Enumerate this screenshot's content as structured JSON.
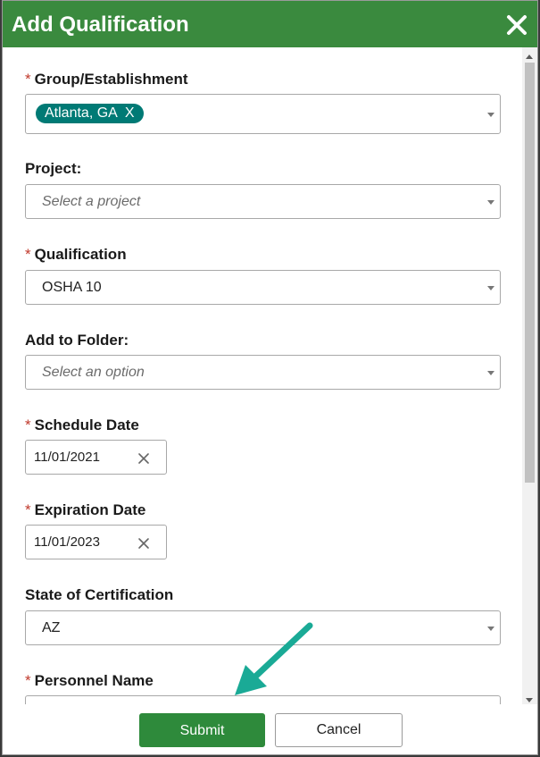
{
  "dialog": {
    "title": "Add Qualification",
    "close_icon": "close-icon"
  },
  "fields": {
    "group": {
      "label": "Group/Establishment",
      "required_mark": "*",
      "tag_text": "Atlanta, GA",
      "tag_remove": "X"
    },
    "project": {
      "label": "Project:",
      "placeholder": "Select a project"
    },
    "qualification": {
      "label": "Qualification",
      "required_mark": "*",
      "value": "OSHA 10"
    },
    "folder": {
      "label": "Add to Folder:",
      "placeholder": "Select an option"
    },
    "schedule_date": {
      "label": "Schedule Date",
      "required_mark": "*",
      "value": "11/01/2021"
    },
    "expiration_date": {
      "label": "Expiration Date",
      "required_mark": "*",
      "value": "11/01/2023"
    },
    "state": {
      "label": "State of Certification",
      "value": "AZ"
    },
    "personnel": {
      "label": "Personnel Name",
      "required_mark": "*"
    }
  },
  "footer": {
    "submit_label": "Submit",
    "cancel_label": "Cancel"
  },
  "colors": {
    "header": "#3a8a3e",
    "tag": "#007a75",
    "submit": "#2e8a3b",
    "required": "#c0392b",
    "annotation_arrow": "#1aaa96"
  }
}
